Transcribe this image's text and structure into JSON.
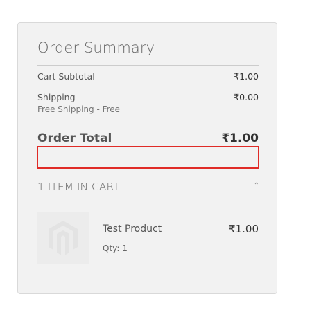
{
  "summary": {
    "title": "Order Summary",
    "subtotal": {
      "label": "Cart Subtotal",
      "value": "₹1.00"
    },
    "shipping": {
      "label": "Shipping",
      "method": "Free Shipping - Free",
      "value": "₹0.00"
    },
    "total": {
      "label": "Order Total",
      "value": "₹1.00"
    },
    "highlight_color": "#e02b27"
  },
  "cart": {
    "toggle_label": "1 ITEM IN CART",
    "toggle_icon": "chevron-up-icon",
    "items": [
      {
        "name": "Test Product",
        "qty": "Qty: 1",
        "price": "₹1.00",
        "image_icon": "magento-logo-icon"
      }
    ]
  }
}
